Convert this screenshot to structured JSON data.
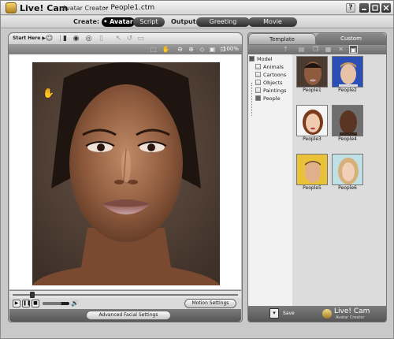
{
  "window": {
    "app_title": "Live! Cam",
    "app_subtitle": "Avatar Creator",
    "file_name": "-- People1.ctm",
    "help_label": "?"
  },
  "modebar": {
    "create_label": "Create:",
    "avatar_label": "• Avatar",
    "script_label": "Script",
    "output_label": "Output :",
    "greeting_label": "Greeting",
    "movie_label": "Movie"
  },
  "left_panel": {
    "start_label": "Start Here ▶",
    "zoom_level": "100%",
    "timeline_position": 0.08,
    "volume_level": 0.7,
    "motion_settings_label": "Motion Settings",
    "advanced_label": "Advanced Facial Settings"
  },
  "right_panel": {
    "tabs": [
      "Template",
      "Custom"
    ],
    "tree_root": "Model",
    "tree_items": [
      "Animals",
      "Cartoons",
      "Objects",
      "Paintings",
      "People"
    ],
    "thumbnails": [
      "People1",
      "People2",
      "People3",
      "People4",
      "People5",
      "People6"
    ],
    "save_label": "Save",
    "brand_title": "Live! Cam",
    "brand_subtitle": "Avatar Creator"
  },
  "colors": {
    "panel_bg": "#b9b9b9",
    "active_pill": "#000000",
    "skin": "#8a5a3e"
  }
}
